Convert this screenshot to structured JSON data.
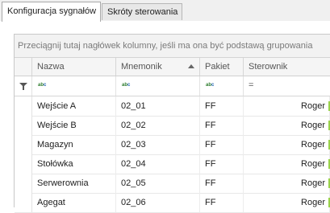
{
  "tabs": [
    {
      "label": "Konfiguracja sygnałów",
      "active": true
    },
    {
      "label": "Skróty sterowania",
      "active": false
    }
  ],
  "group_panel": {
    "hint": "Przeciągnij tutaj nagłówek kolumny, jeśli ma ona być podstawą grupowania"
  },
  "columns": [
    {
      "label": "Nazwa"
    },
    {
      "label": "Mnemonik",
      "sorted": "ascending"
    },
    {
      "label": "Pakiet"
    },
    {
      "label": "Sterownik"
    }
  ],
  "filter_row": {
    "nazwa_op": "abc",
    "mnemonik_op": "abc",
    "pakiet_op": "abc",
    "sterownik_op": "="
  },
  "rows": [
    {
      "nazwa": "Wejście A",
      "mnemonik": "02_01",
      "pakiet": "FF",
      "sterownik": "Roger"
    },
    {
      "nazwa": "Wejście B",
      "mnemonik": "02_02",
      "pakiet": "FF",
      "sterownik": "Roger"
    },
    {
      "nazwa": "Magazyn",
      "mnemonik": "02_03",
      "pakiet": "FF",
      "sterownik": "Roger"
    },
    {
      "nazwa": "Stołówka",
      "mnemonik": "02_04",
      "pakiet": "FF",
      "sterownik": "Roger"
    },
    {
      "nazwa": "Serwerownia",
      "mnemonik": "02_05",
      "pakiet": "FF",
      "sterownik": "Roger"
    },
    {
      "nazwa": "Agegat",
      "mnemonik": "02_06",
      "pakiet": "FF",
      "sterownik": "Roger"
    }
  ],
  "colors": {
    "accent_edge": "#9ad24a",
    "abc_text": "#2a7a2a",
    "abc_c": "#1a5fb0"
  }
}
